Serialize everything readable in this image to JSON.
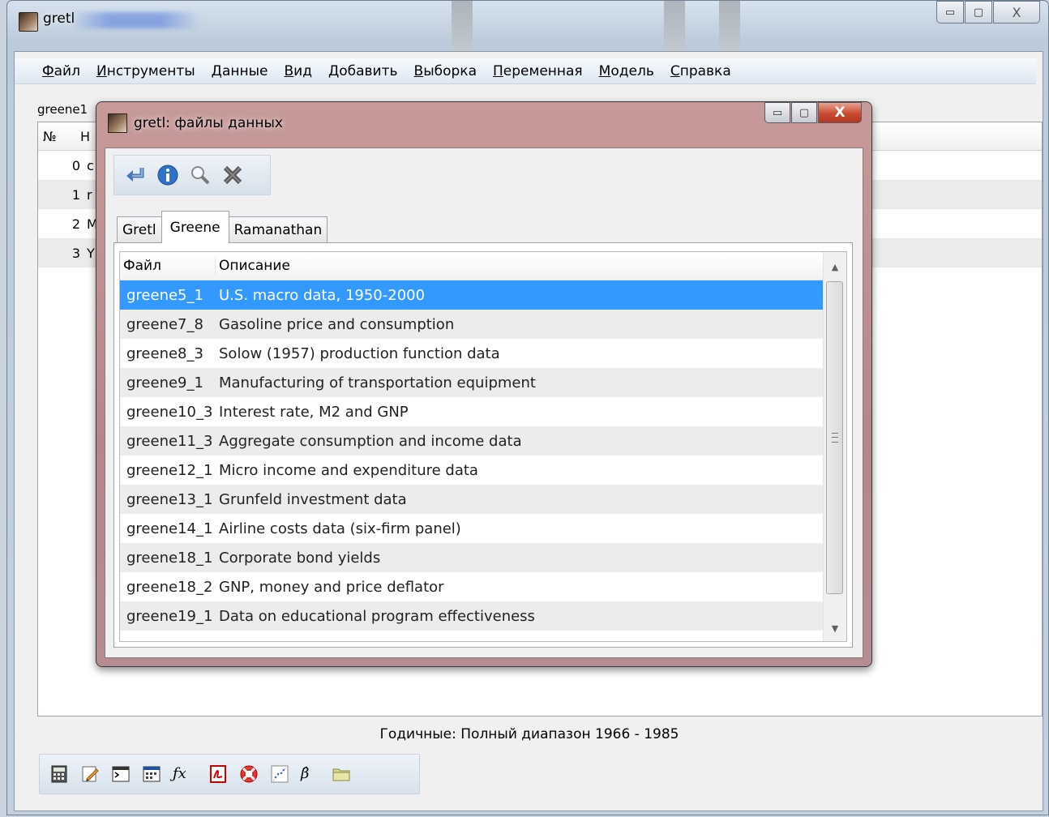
{
  "main_window": {
    "title": "gretl",
    "controls": {
      "minimize": "▭",
      "maximize": "▢",
      "close": "X"
    }
  },
  "menu": [
    {
      "hot": "Ф",
      "rest": "айл"
    },
    {
      "hot": "И",
      "rest": "нструменты"
    },
    {
      "hot": "Д",
      "rest": "анные"
    },
    {
      "hot": "В",
      "rest": "ид"
    },
    {
      "hot": "Д",
      "rest": "обавить"
    },
    {
      "hot": "В",
      "rest": "ыборка"
    },
    {
      "hot": "П",
      "rest": "еременная"
    },
    {
      "hot": "М",
      "rest": "одель"
    },
    {
      "hot": "С",
      "rest": "правка"
    }
  ],
  "dataset_name": "greene1",
  "varlist": {
    "col_num": "№",
    "col_name": "Н",
    "rows": [
      {
        "num": "0",
        "name": "c"
      },
      {
        "num": "1",
        "name": "r"
      },
      {
        "num": "2",
        "name": "M"
      },
      {
        "num": "3",
        "name": "Y"
      }
    ]
  },
  "status": "Годичные: Полный диапазон 1966 - 1985",
  "main_toolbar_icons": [
    "calculator-icon",
    "edit-icon",
    "console-icon",
    "session-icon",
    "function-icon",
    "pdf-icon",
    "help-icon",
    "plot-icon",
    "beta-icon",
    "folder-icon"
  ],
  "main_toolbar_glyphs": {
    "function": "ƒx",
    "beta": "β̂"
  },
  "dialog": {
    "title": "gretl: файлы данных",
    "controls": {
      "minimize": "▭",
      "maximize": "▢",
      "close": "X"
    },
    "toolbar_icons": [
      "open-icon",
      "info-icon",
      "search-icon",
      "close-icon"
    ],
    "tabs": [
      {
        "label": "Gretl",
        "active": false
      },
      {
        "label": "Greene",
        "active": true
      },
      {
        "label": "Ramanathan",
        "active": false
      }
    ],
    "list": {
      "col_file": "Файл",
      "col_desc": "Описание",
      "rows": [
        {
          "file": "greene5_1",
          "desc": "U.S. macro data, 1950-2000",
          "selected": true
        },
        {
          "file": "greene7_8",
          "desc": "Gasoline price and consumption"
        },
        {
          "file": "greene8_3",
          "desc": "Solow (1957) production function data"
        },
        {
          "file": "greene9_1",
          "desc": "Manufacturing of transportation equipment"
        },
        {
          "file": "greene10_3",
          "desc": "Interest rate, M2 and GNP"
        },
        {
          "file": "greene11_3",
          "desc": "Aggregate consumption and income data"
        },
        {
          "file": "greene12_1",
          "desc": "Micro income and expenditure data"
        },
        {
          "file": "greene13_1",
          "desc": "Grunfeld investment data"
        },
        {
          "file": "greene14_1",
          "desc": "Airline costs data (six-firm panel)"
        },
        {
          "file": "greene18_1",
          "desc": "Corporate bond yields"
        },
        {
          "file": "greene18_2",
          "desc": "GNP, money and price deflator"
        },
        {
          "file": "greene19_1",
          "desc": "Data on educational program effectiveness"
        }
      ]
    },
    "scroll": {
      "up": "▲",
      "down": "▼"
    }
  },
  "colors": {
    "selection": "#3399ff",
    "close_button": "#c94a2e"
  }
}
